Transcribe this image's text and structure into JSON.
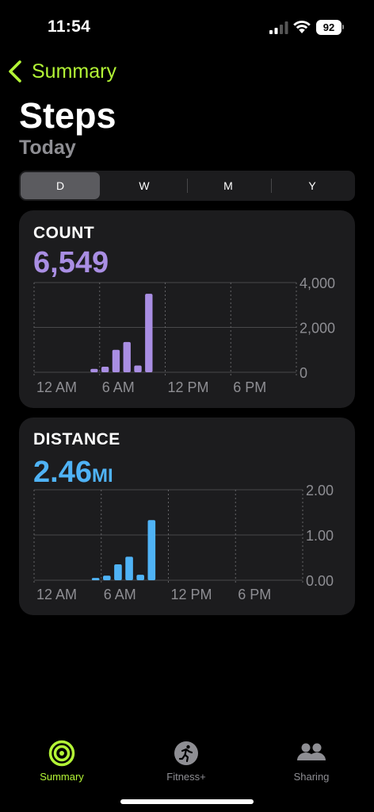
{
  "status_bar": {
    "time": "11:54",
    "battery": "92"
  },
  "nav": {
    "back_label": "Summary",
    "title": "Steps",
    "subtitle": "Today"
  },
  "segments": [
    "D",
    "W",
    "M",
    "Y"
  ],
  "selected_segment": "D",
  "count_card": {
    "label": "COUNT",
    "value": "6,549"
  },
  "distance_card": {
    "label": "DISTANCE",
    "value": "2.46",
    "unit": "MI"
  },
  "tabbar": {
    "items": [
      {
        "label": "Summary",
        "icon": "activity-rings-icon",
        "active": true
      },
      {
        "label": "Fitness+",
        "icon": "running-person-icon",
        "active": false
      },
      {
        "label": "Sharing",
        "icon": "people-icon",
        "active": false
      }
    ]
  },
  "colors": {
    "accent": "#b3f536",
    "count": "#a98ee3",
    "distance": "#4fb3f6"
  },
  "chart_data": [
    {
      "type": "bar",
      "title": "COUNT",
      "x_tick_labels": [
        "12 AM",
        "6 AM",
        "12 PM",
        "6 PM"
      ],
      "y_tick_labels": [
        "4,000",
        "2,000",
        "0"
      ],
      "ylim": [
        0,
        4000
      ],
      "grid": true,
      "series": [
        {
          "x": [
            "5 AM",
            "6 AM",
            "7 AM",
            "8 AM",
            "9 AM",
            "10 AM"
          ],
          "values": [
            150,
            250,
            1000,
            1350,
            300,
            3500
          ]
        }
      ]
    },
    {
      "type": "bar",
      "title": "DISTANCE",
      "x_tick_labels": [
        "12 AM",
        "6 AM",
        "12 PM",
        "6 PM"
      ],
      "y_tick_labels": [
        "2.00",
        "1.00",
        "0.00"
      ],
      "ylim": [
        0,
        2
      ],
      "grid": true,
      "series": [
        {
          "x": [
            "5 AM",
            "6 AM",
            "7 AM",
            "8 AM",
            "9 AM",
            "10 AM"
          ],
          "values": [
            0.05,
            0.1,
            0.35,
            0.52,
            0.12,
            1.33
          ]
        }
      ]
    }
  ]
}
